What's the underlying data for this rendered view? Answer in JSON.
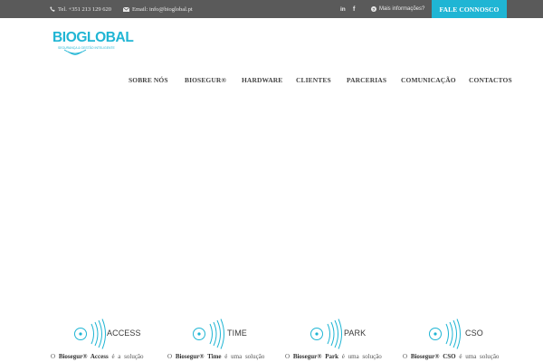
{
  "topbar": {
    "phone": "Tel. +351 213 129 620",
    "email": "Email: info@bioglobal.pt",
    "linkedin": "in",
    "facebook": "f",
    "more_info": "Mais informações?",
    "contact_button": "FALE CONNOSCO",
    "colors": {
      "bar": "#5a5a5a",
      "button": "#1fb5d4"
    }
  },
  "logo": {
    "text": "BIOGLOBAL",
    "tagline": "SEGURANÇA & GESTÃO INTELIGENTE",
    "color": "#1fb5d4"
  },
  "nav": {
    "items": [
      "SOBRE NÓS",
      "BIOSEGUR®",
      "HARDWARE",
      "CLIENTES",
      "PARCERIAS",
      "COMUNICAÇÃO",
      "CONTACTOS"
    ]
  },
  "products": [
    {
      "name": "ACCESS",
      "prefix": "O",
      "brand": "Biosegur® Access",
      "suffix": "é a solução"
    },
    {
      "name": "TIME",
      "prefix": "O",
      "brand": "Biosegur® Time",
      "suffix": "é uma solução"
    },
    {
      "name": "PARK",
      "prefix": "O",
      "brand": "Biosegur® Park",
      "suffix": "é uma solução"
    },
    {
      "name": "CSO",
      "prefix": "O",
      "brand": "Biosegur® CSO",
      "suffix": "é uma solução"
    }
  ]
}
